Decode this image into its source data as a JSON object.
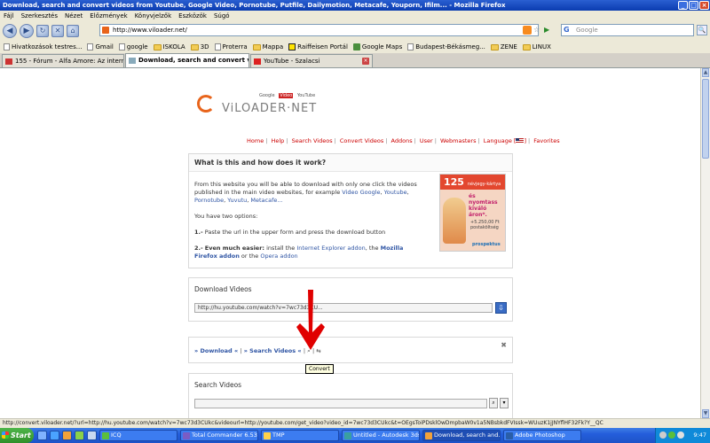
{
  "window": {
    "title": "Download, search and convert videos from Youtube, Google Video, Pornotube, Putfile, Dailymotion, Metacafe, Youporn, Ifilm... - Mozilla Firefox"
  },
  "menu": [
    "Fájl",
    "Szerkesztés",
    "Nézet",
    "Előzmények",
    "Könyvjelzők",
    "Eszközök",
    "Súgó"
  ],
  "navbar": {
    "url": "http://www.viloader.net/",
    "search_placeholder": "Google"
  },
  "bookmarks": [
    {
      "label": "Hivatkozások testres...",
      "icon": "page-icon"
    },
    {
      "label": "Gmail",
      "icon": "page-icon"
    },
    {
      "label": "google",
      "icon": "page-icon"
    },
    {
      "label": "ISKOLA",
      "icon": "folder-icon"
    },
    {
      "label": "3D",
      "icon": "folder-icon"
    },
    {
      "label": "Proterra",
      "icon": "page-icon"
    },
    {
      "label": "Mappa",
      "icon": "folder-icon"
    },
    {
      "label": "Raiffeisen Portál",
      "icon": "raiff-icon"
    },
    {
      "label": "Google Maps",
      "icon": "gmaps-icon"
    },
    {
      "label": "Budapest-Békásmeg...",
      "icon": "page-icon"
    },
    {
      "label": "ZENE",
      "icon": "folder-icon"
    },
    {
      "label": "LINUX",
      "icon": "folder-icon"
    }
  ],
  "tabs": [
    {
      "label": "155 - Fórum - Alfa Amore: Az internet..."
    },
    {
      "label": "Download, search and convert vi..."
    },
    {
      "label": "YouTube - Szalacsi"
    }
  ],
  "logo": {
    "name": "ViLOADER·NET",
    "partners": [
      "Google",
      "Video",
      "YouTube"
    ]
  },
  "sitenav": [
    "Home",
    "Help",
    "Search Videos",
    "Convert Videos",
    "Addons",
    "User",
    "Webmasters",
    "Language [",
    "]",
    "Favorites"
  ],
  "info": {
    "title": "What is this and how does it work?",
    "p1": "From this website you will be able to download with only one click the videos published in the main video websites, for example",
    "p1_links": [
      "Video Google",
      "Youtube",
      "Pornotube",
      "Yuvutu",
      "Metacafe..."
    ],
    "p2": "You have two options:",
    "opt1_num": "1.-",
    "opt1_text": "Paste the url in the upper form and press the download button",
    "opt2_num": "2.-",
    "opt2_bold": "Even much easier:",
    "opt2_text": "install the",
    "opt2_link1": "Internet Explorer addon",
    "opt2_mid": ", the",
    "opt2_link2": "Mozilla Firefox addon",
    "opt2_or": "or the",
    "opt2_link3": "Opera addon"
  },
  "ad": {
    "number": "125",
    "top_small": "névjegy-kártya",
    "mid": "és nyomtass kiváló áron*.",
    "price": "+5.250,00 Ft postaköltség",
    "brand": "prospektus"
  },
  "download": {
    "title": "Download Videos",
    "url_value": "http://hu.youtube.com/watch?v=7wc73d3CU..."
  },
  "convert": {
    "download_link": "» Download «",
    "search_link": "» Search Videos «",
    "tooltip": "Convert"
  },
  "search": {
    "title": "Search Videos"
  },
  "statusbar": {
    "text": "http://convert.viloader.net/?url=http://hu.youtube.com/watch?v=7wc73d3CUkc&videourl=http://youtube.com/get_video?video_id=7wc73d3CUkc&t=OEgsToiPDsklOwDmpbaW0v1a5NBsbkdFVIssk=WUuzK1jJNYflHF32Fk?Y__QC"
  },
  "taskbar": {
    "start": "Start",
    "tasks": [
      {
        "label": "ICQ"
      },
      {
        "label": "Total Commander 6.53 - ..."
      },
      {
        "label": "TMP"
      },
      {
        "label": "Untitled - Autodesk 3ds ..."
      },
      {
        "label": "Download, search and..."
      },
      {
        "label": "Adobe Photoshop"
      }
    ],
    "clock": "9:47"
  }
}
